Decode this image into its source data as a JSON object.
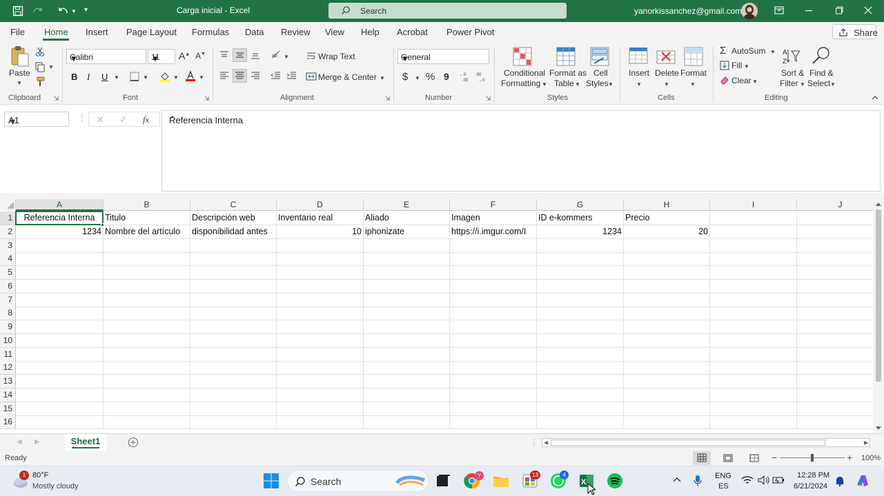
{
  "window": {
    "title": "Carga inicial  -  Excel",
    "search_placeholder": "Search",
    "account": "yanorkissanchez@gmail.com"
  },
  "tabs": [
    "File",
    "Home",
    "Insert",
    "Page Layout",
    "Formulas",
    "Data",
    "Review",
    "View",
    "Help",
    "Acrobat",
    "Power Pivot"
  ],
  "share_label": "Share",
  "ribbon": {
    "clipboard": {
      "paste": "Paste",
      "label": "Clipboard"
    },
    "font": {
      "family": "Calibri",
      "size": "11",
      "bold": "B",
      "italic": "I",
      "underline": "U",
      "label": "Font"
    },
    "alignment": {
      "wrap_text": "Wrap Text",
      "merge_center": "Merge & Center",
      "label": "Alignment"
    },
    "number": {
      "format": "General",
      "currency": "$",
      "percent": "%",
      "comma": "9",
      "label": "Number"
    },
    "styles": {
      "conditional_1": "Conditional",
      "conditional_2": "Formatting",
      "format_as_1": "Format as",
      "format_as_2": "Table",
      "cell_styles_1": "Cell",
      "cell_styles_2": "Styles",
      "label": "Styles"
    },
    "cells": {
      "insert": "Insert",
      "delete": "Delete",
      "format": "Format",
      "label": "Cells"
    },
    "editing": {
      "autosum": "AutoSum",
      "fill": "Fill",
      "clear": "Clear",
      "sort_1": "Sort &",
      "sort_2": "Filter",
      "find_1": "Find &",
      "find_2": "Select",
      "label": "Editing"
    }
  },
  "formula_bar": {
    "name_box": "A1",
    "fx": "fx",
    "content": "Referencia Interna"
  },
  "sheet": {
    "columns": [
      "A",
      "B",
      "C",
      "D",
      "E",
      "F",
      "G",
      "H",
      "I",
      "J"
    ],
    "rows": [
      "1",
      "2",
      "3",
      "4",
      "5",
      "6",
      "7",
      "8",
      "9",
      "10",
      "11",
      "12",
      "13",
      "14",
      "15",
      "16"
    ],
    "row1": [
      "Referencia Interna",
      "Titulo",
      "Descripción web",
      "Inventario real",
      "Aliado",
      "Imagen",
      "ID e-kommers",
      "Precio",
      "",
      ""
    ],
    "row2": [
      "1234",
      "Nombre del artículo",
      "disponibilidad antes",
      "10",
      "iphonizate",
      "https://i.imgur.com/I",
      "1234",
      "20",
      "",
      ""
    ]
  },
  "sheet_tab": "Sheet1",
  "status": {
    "ready": "Ready",
    "zoom": "100%"
  },
  "taskbar": {
    "weather_temp": "80°F",
    "weather_desc": "Mostly cloudy",
    "weather_badge": "1",
    "search": "Search",
    "lang_1": "ENG",
    "lang_2": "ES",
    "time": "12:28 PM",
    "date": "6/21/2024",
    "teams_badge": "13",
    "whatsapp_badge": "4"
  },
  "colors": {
    "excel_green": "#217346",
    "ribbon_bg": "#f3f3f3"
  }
}
